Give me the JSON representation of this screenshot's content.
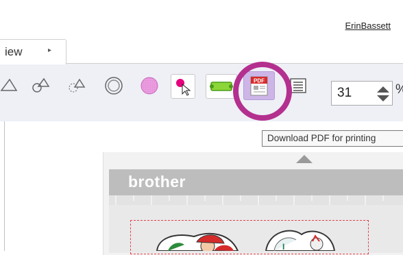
{
  "header": {
    "user_name": "ErinBassett"
  },
  "tab": {
    "label": "iew",
    "arrow": "▸"
  },
  "toolbar": {
    "buttons": [
      {
        "name": "triangle-shape-icon"
      },
      {
        "name": "circle-triangle-shape-icon"
      },
      {
        "name": "dashed-shapes-icon"
      },
      {
        "name": "double-circle-icon"
      },
      {
        "name": "pink-grid-circle-icon"
      },
      {
        "name": "pointer-select-icon"
      },
      {
        "name": "green-bar-icon"
      },
      {
        "name": "pdf-icon"
      },
      {
        "name": "list-icon"
      }
    ],
    "pdf_label": "PDF",
    "zoom_value": "31",
    "zoom_unit": "%"
  },
  "tooltip": {
    "text": "Download PDF for printing"
  },
  "preview": {
    "brand": "brother"
  },
  "colors": {
    "highlight_ring": "#b4308f",
    "pdf_button_bg": "#cdb5e8",
    "toolbar_bg": "#eef0f6",
    "cut_line": "#e2404a"
  }
}
